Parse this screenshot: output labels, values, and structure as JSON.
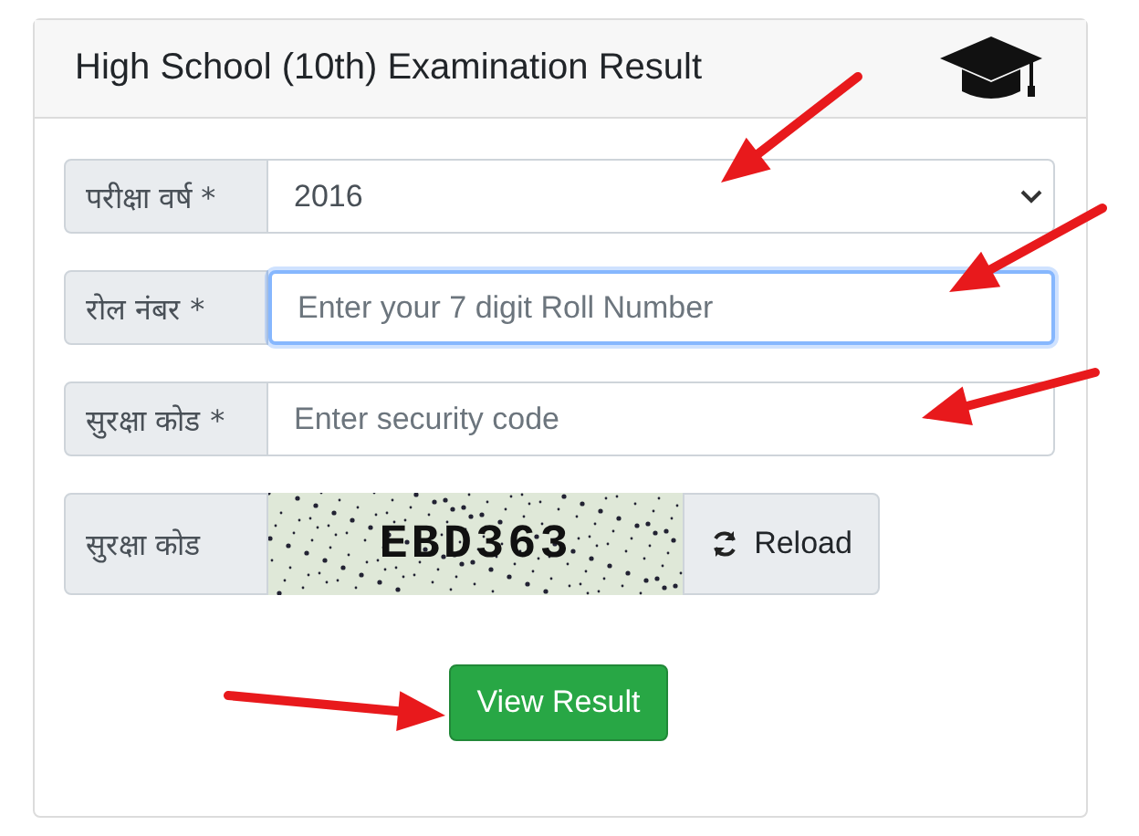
{
  "card": {
    "title": "High School (10th) Examination Result"
  },
  "fields": [
    {
      "kind": "select",
      "label": "परीक्षा वर्ष *",
      "value": "2016"
    },
    {
      "kind": "input",
      "label": "रोल नंबर *",
      "placeholder": "Enter your 7 digit Roll Number",
      "focused": true
    },
    {
      "kind": "input",
      "label": "सुरक्षा कोड *",
      "placeholder": "Enter security code",
      "focused": false
    },
    {
      "kind": "captcha",
      "label": "सुरक्षा कोड",
      "code": "EBD363",
      "button": "Reload"
    }
  ],
  "submit": "View Result"
}
